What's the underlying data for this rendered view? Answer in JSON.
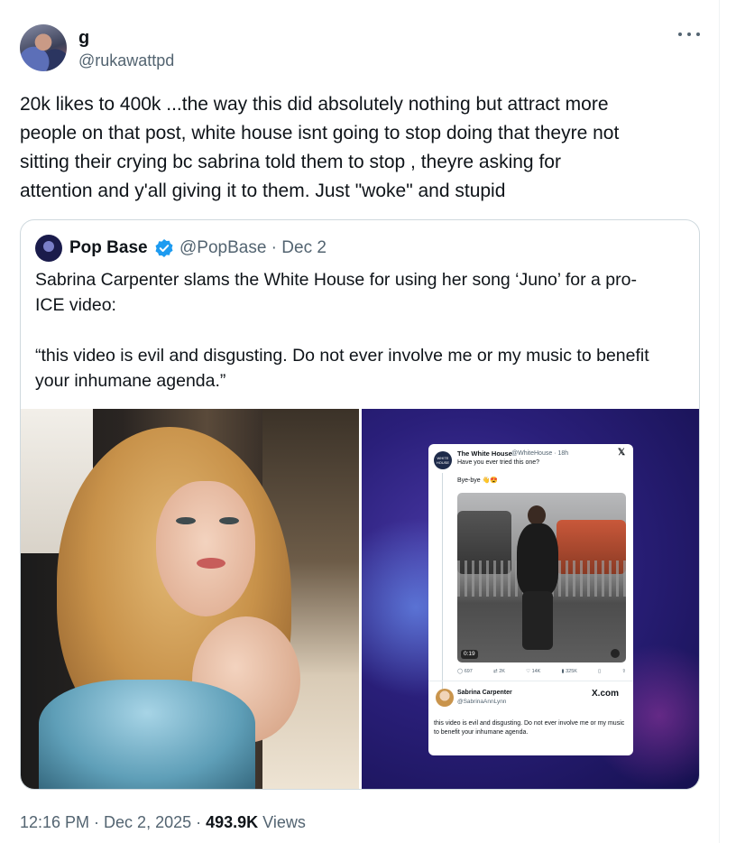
{
  "author": {
    "display_name": "g",
    "handle": "@rukawattpd"
  },
  "tweet": {
    "text": "20k likes to 400k ...the way this did absolutely nothing but attract more\npeople on that post,  white house isnt going to stop doing that theyre not\nsitting their crying bc sabrina told them to stop , theyre asking for\nattention and y'all giving it to them. Just \"woke\" and stupid"
  },
  "quote": {
    "name": "Pop Base",
    "handle_date": "@PopBase · Dec 2",
    "text": "Sabrina Carpenter slams the White House for using her song ‘Juno’ for a pro-\nICE video:\n\n“this video is evil and disgusting. Do not ever involve me or my music to benefit\nyour inhumane agenda.”",
    "embedded": {
      "wh_name": "The White House",
      "wh_handle": "@WhiteHouse · 18h",
      "wh_avatar_text": "WHITE HOUSE",
      "x_logo": "𝕏",
      "line1": "Have you ever tried this one?",
      "line2": "Bye-bye 👋😍",
      "video_time": "0:19",
      "stats": {
        "replies": "697",
        "reposts": "2K",
        "likes": "14K",
        "views": "325K"
      },
      "sc_name": "Sabrina Carpenter",
      "sc_handle": "@SabrinaAnnLynn",
      "xcom": "X.com",
      "sc_quote": "this video is evil and disgusting. Do not ever involve me or my music to benefit your inhumane agenda."
    }
  },
  "footer": {
    "time_date": "12:16 PM · Dec 2, 2025 · ",
    "views_count": "493.9K",
    "views_label": " Views"
  },
  "colors": {
    "text": "#0f1419",
    "secondary": "#536471",
    "verified": "#1d9bf0",
    "border": "#cfd9de"
  }
}
